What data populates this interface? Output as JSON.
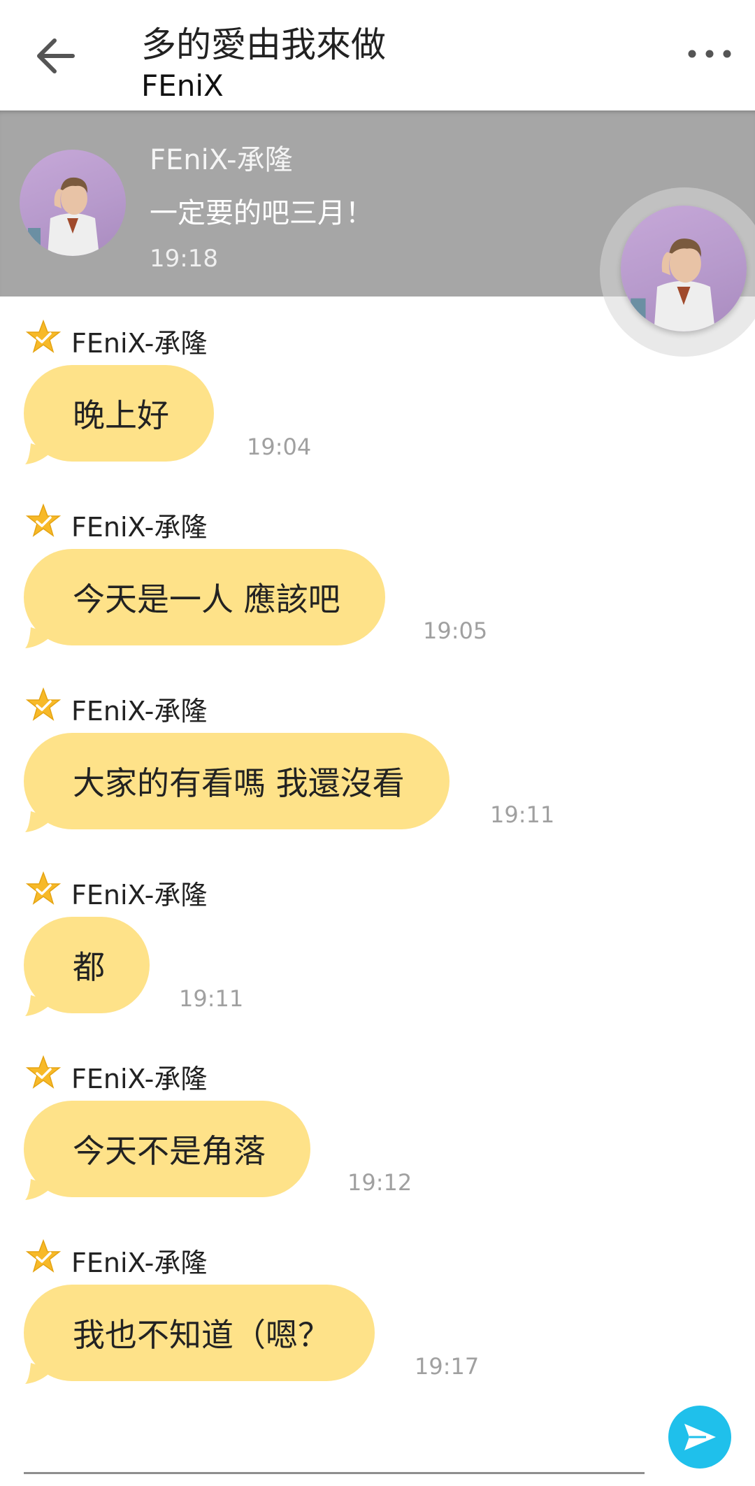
{
  "header": {
    "title": "多的愛由我來做",
    "subtitle": "FEniX",
    "back_icon": "arrow-left-icon",
    "more_icon": "more-horizontal-icon"
  },
  "pinned": {
    "sender": "FEniX-承隆",
    "message": "一定要的吧三月！",
    "time": "19:18"
  },
  "messages": [
    {
      "sender": "FEniX-承隆",
      "text": "晚上好",
      "time": "19:04"
    },
    {
      "sender": "FEniX-承隆",
      "text": "今天是一人 應該吧",
      "time": "19:05"
    },
    {
      "sender": "FEniX-承隆",
      "text": "大家的有看嗎 我還沒看",
      "time": "19:11"
    },
    {
      "sender": "FEniX-承隆",
      "text": "都",
      "time": "19:11"
    },
    {
      "sender": "FEniX-承隆",
      "text": "今天不是角落",
      "time": "19:12"
    },
    {
      "sender": "FEniX-承隆",
      "text": "我也不知道（嗯？",
      "time": "19:17"
    }
  ],
  "composer": {
    "send_icon": "send-icon"
  },
  "colors": {
    "bubble": "#fee289",
    "banner": "#a6a6a6",
    "send_button": "#1fc0eb",
    "star": "#f7b928"
  }
}
